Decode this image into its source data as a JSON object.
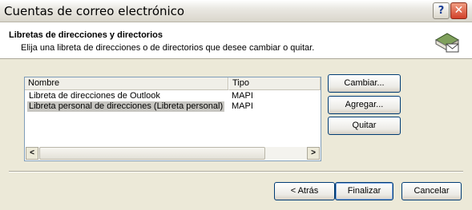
{
  "window": {
    "title": "Cuentas de correo electrónico",
    "help_label": "?",
    "close_label": "✕"
  },
  "header": {
    "title": "Libretas de direcciones y directorios",
    "subtitle": "Elija una libreta de direcciones o de directorios que desee cambiar o quitar.",
    "icon": "address-book-icon"
  },
  "list": {
    "columns": [
      "Nombre",
      "Tipo"
    ],
    "rows": [
      {
        "name": "Libreta de direcciones de Outlook",
        "type": "MAPI",
        "selected": false
      },
      {
        "name": "Libreta personal de direcciones (Libreta personal)",
        "type": "MAPI",
        "selected": true
      }
    ],
    "scroll_left": "<",
    "scroll_right": ">"
  },
  "side_buttons": {
    "change": "Cambiar...",
    "add": "Agregar...",
    "remove": "Quitar"
  },
  "footer": {
    "back": "< Atrás",
    "finish": "Finalizar",
    "cancel": "Cancelar"
  }
}
